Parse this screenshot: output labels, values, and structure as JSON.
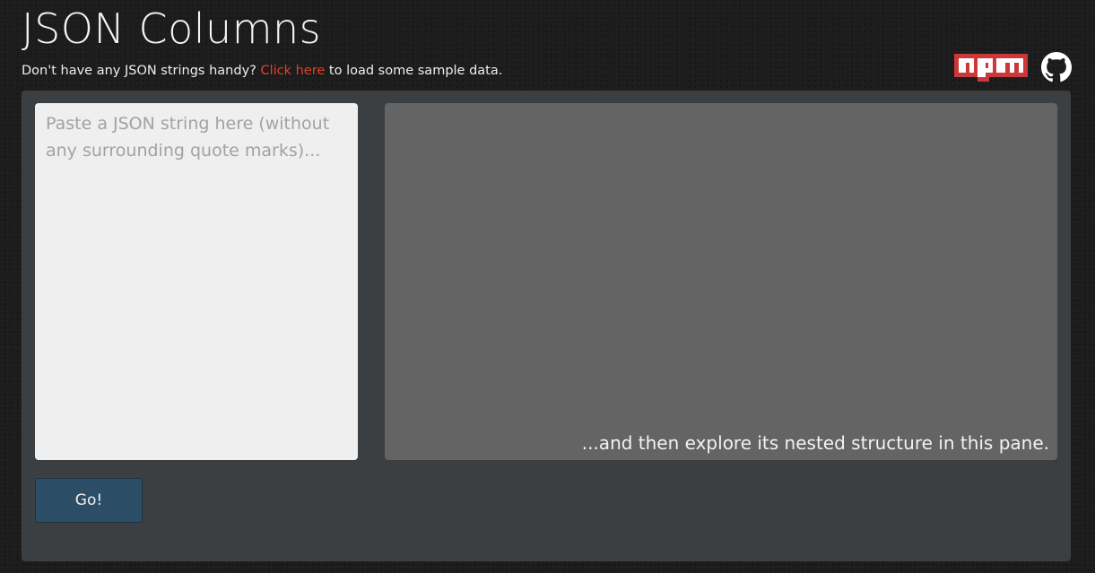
{
  "header": {
    "title": "JSON Columns",
    "subtitle_before": "Don't have any JSON strings handy?",
    "subtitle_link": "Click here",
    "subtitle_after": "to load some sample data."
  },
  "links": {
    "npm_icon": "npm-logo",
    "github_icon": "github-logo"
  },
  "editor": {
    "input_value": "",
    "input_placeholder": "Paste a JSON string here (without any surrounding quote marks)...",
    "output_hint": "...and then explore its nested structure in this pane.",
    "go_label": "Go!"
  },
  "colors": {
    "link": "#e0402a",
    "npm_red": "#cb3837",
    "button": "#2b4d66",
    "panel": "#3b3f42",
    "output_pane": "#646464"
  }
}
